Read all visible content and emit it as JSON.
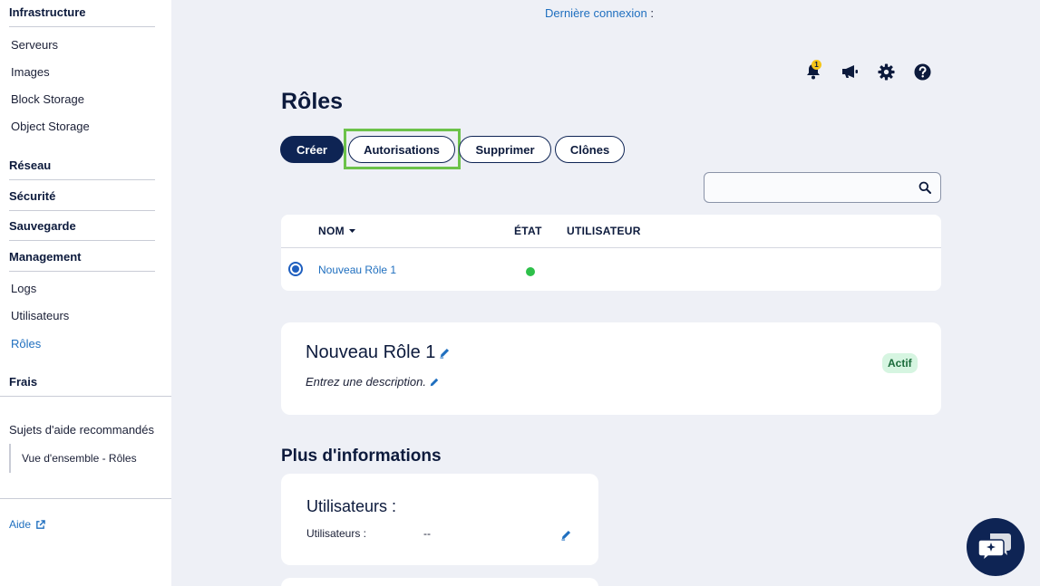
{
  "sidebar": {
    "infrastructure": "Infrastructure",
    "servers": "Serveurs",
    "images": "Images",
    "block_storage": "Block Storage",
    "object_storage": "Object Storage",
    "network": "Réseau",
    "security": "Sécurité",
    "backup": "Sauvegarde",
    "management": "Management",
    "logs": "Logs",
    "users": "Utilisateurs",
    "roles": "Rôles",
    "fees": "Frais",
    "help_title": "Sujets d'aide recommandés",
    "help_link": "Vue d'ensemble - Rôles",
    "aide": "Aide"
  },
  "header": {
    "last_login": "Dernière connexion",
    "last_login_colon": ":",
    "notification_count": "1"
  },
  "page": {
    "title": "Rôles"
  },
  "toolbar": {
    "create": "Créer",
    "permissions": "Autorisations",
    "delete": "Supprimer",
    "clones": "Clônes"
  },
  "search": {
    "placeholder": ""
  },
  "table": {
    "col_name": "NOM",
    "col_state": "ÉTAT",
    "col_user": "UTILISATEUR",
    "rows": [
      {
        "name": "Nouveau Rôle 1",
        "state": "active"
      }
    ]
  },
  "detail": {
    "title": "Nouveau Rôle 1",
    "description": "Entrez une description.",
    "status": "Actif"
  },
  "more_info": {
    "title": "Plus d'informations",
    "users_card_title": "Utilisateurs :",
    "users_label": "Utilisateurs :",
    "users_value": "--"
  },
  "colors": {
    "navy": "#0e2454",
    "link_blue": "#1f6fbf",
    "active_green": "#2ec04a",
    "highlight_green": "#6cc24a",
    "background": "#eef0f6"
  }
}
